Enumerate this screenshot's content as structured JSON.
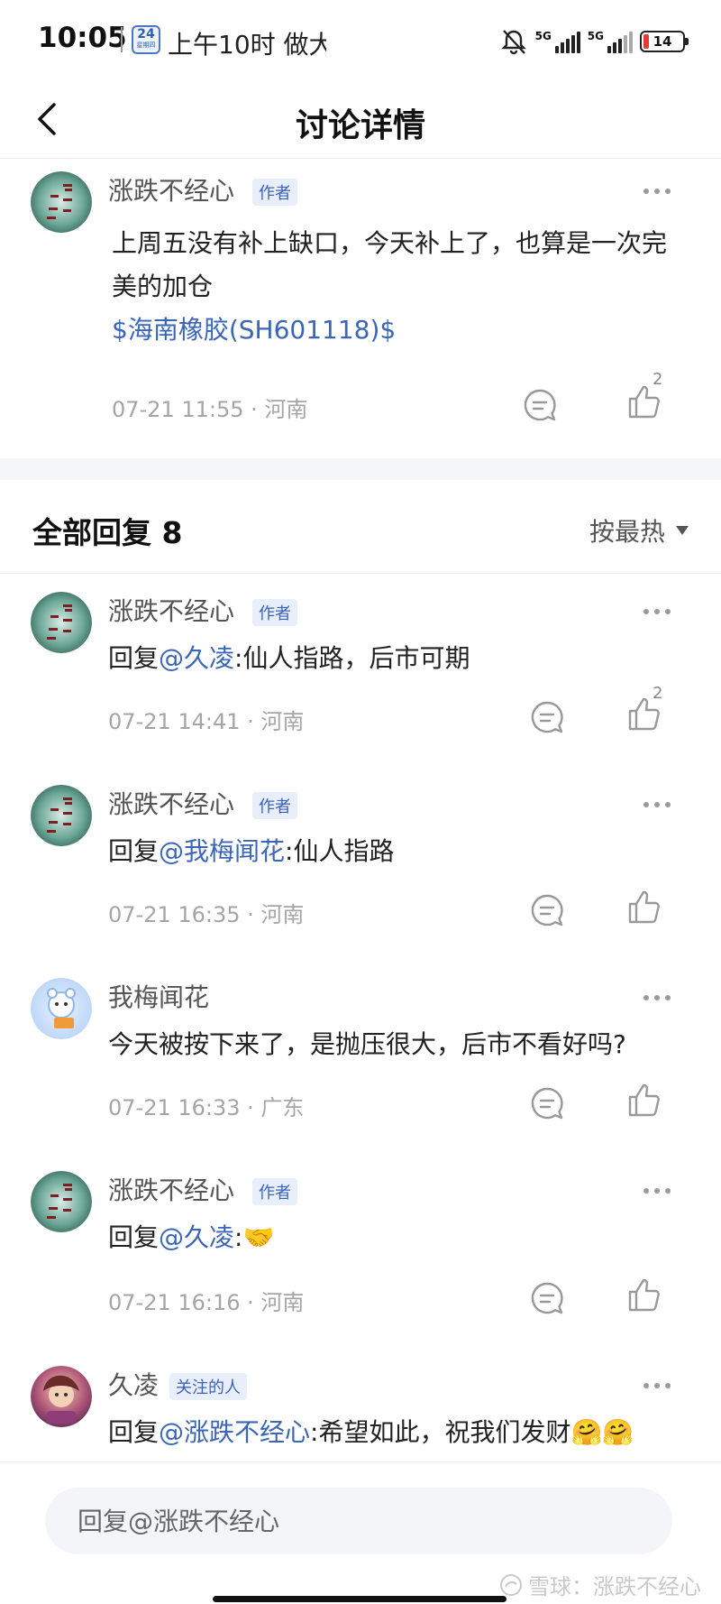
{
  "status_bar": {
    "time": "10:05",
    "calendar_day": "24",
    "calendar_sub": "星期四",
    "notification": "上午10时 做大",
    "network_1": "5G",
    "network_2": "5G",
    "battery": "14",
    "battery_level": 0.14,
    "battery_color": "#e53935"
  },
  "nav": {
    "title": "讨论详情",
    "back_icon": "chevron-left-icon"
  },
  "post": {
    "author": "涨跌不经心",
    "badge": "作者",
    "line1": "上周五没有补上缺口，今天补上了，也算是一次完",
    "line2": "美的加仓",
    "stock_link": "$海南橡胶(SH601118)$",
    "meta": "07-21 11:55 · 河南",
    "like_count": "2"
  },
  "replies_header": {
    "title": "全部回复 8",
    "sort_label": "按最热"
  },
  "replies": [
    {
      "author": "涨跌不经心",
      "badge": "作者",
      "prefix": "回复",
      "mention": "@久凌",
      "suffix": ":仙人指路，后市可期",
      "meta": "07-21 14:41 · 河南",
      "like_count": "2"
    },
    {
      "author": "涨跌不经心",
      "badge": "作者",
      "prefix": "回复",
      "mention": "@我梅闻花",
      "suffix": ":仙人指路",
      "meta": "07-21 16:35 · 河南",
      "like_count": ""
    },
    {
      "author": "我梅闻花",
      "badge": "",
      "prefix": "今天被按下来了，是抛压很大，后市不看好吗?",
      "mention": "",
      "suffix": "",
      "meta": "07-21 16:33 · 广东",
      "like_count": ""
    },
    {
      "author": "涨跌不经心",
      "badge": "作者",
      "prefix": "回复",
      "mention": "@久凌",
      "suffix": ":",
      "emoji": "🤝",
      "meta": "07-21 16:16 · 河南",
      "like_count": ""
    },
    {
      "author": "久凌",
      "badge": "关注的人",
      "prefix": "回复",
      "mention": "@涨跌不经心",
      "suffix": ":希望如此，祝我们发财",
      "emoji": "🤗🤗",
      "meta": "",
      "like_count": ""
    }
  ],
  "input": {
    "placeholder": "回复@涨跌不经心"
  },
  "watermark": {
    "text": "雪球：涨跌不经心"
  },
  "colors": {
    "link": "#3b66b8",
    "badge_bg": "#e9effa",
    "meta": "#a5a5a5"
  }
}
